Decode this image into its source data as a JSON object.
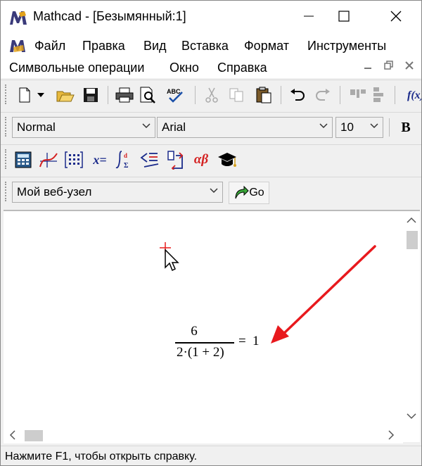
{
  "window": {
    "title": "Mathcad - [Безымянный:1]",
    "app_icon": "mathcad-logo-icon"
  },
  "menu": {
    "row1": [
      "Файл",
      "Правка",
      "Вид",
      "Вставка",
      "Формат",
      "Инструменты"
    ],
    "row2": [
      "Символьные операции",
      "Окно",
      "Справка"
    ]
  },
  "format_toolbar": {
    "style": "Normal",
    "font": "Arial",
    "size": "10",
    "bold": "B"
  },
  "math_toolbar": {
    "eval_label": "x=",
    "greek_label": "αβ"
  },
  "web_toolbar": {
    "url": "Мой веб-узел",
    "go_label": "Go"
  },
  "worksheet": {
    "numerator": "6",
    "denominator": "2·(1 + 2)",
    "equals": "=",
    "result": "1",
    "arrow_color": "#e8191d",
    "cursor_color": "#e81c1c"
  },
  "status": {
    "text": "Нажмите F1, чтобы открыть справку."
  }
}
